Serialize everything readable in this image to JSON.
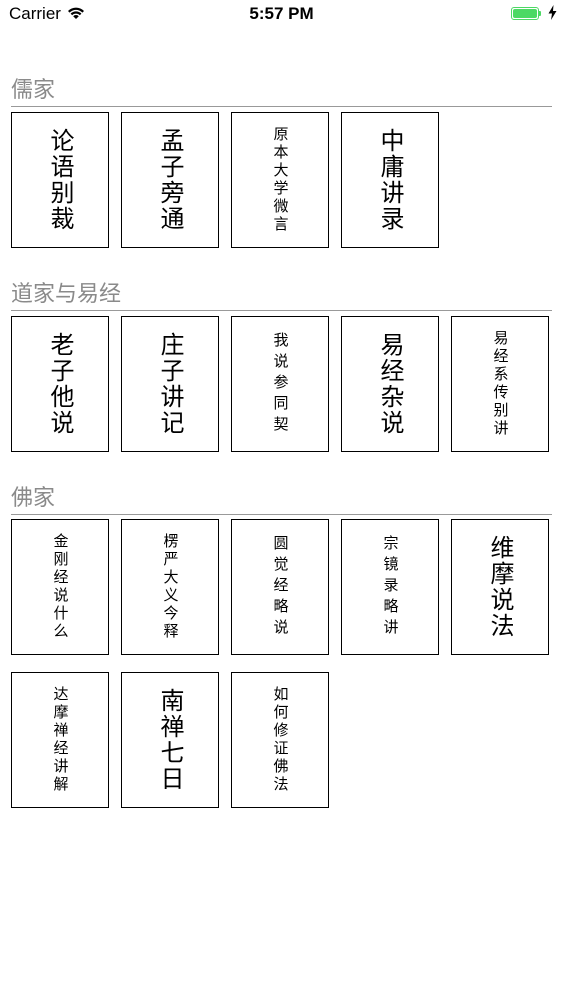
{
  "status_bar": {
    "carrier": "Carrier",
    "time": "5:57 PM",
    "battery_color": "#4cd964"
  },
  "sections": [
    {
      "title": "儒家",
      "books": [
        "论语别裁",
        "孟子旁通",
        "原本大学微言",
        "中庸讲录"
      ]
    },
    {
      "title": "道家与易经",
      "books": [
        "老子他说",
        "庄子讲记",
        "我说参同契",
        "易经杂说",
        "易经系传别讲"
      ]
    },
    {
      "title": "佛家",
      "books": [
        "金刚经说什么",
        "楞严大义今释",
        "圆觉经略说",
        "宗镜录略讲",
        "维摩说法",
        "达摩禅经讲解",
        "南禅七日",
        "如何修证佛法"
      ]
    }
  ]
}
